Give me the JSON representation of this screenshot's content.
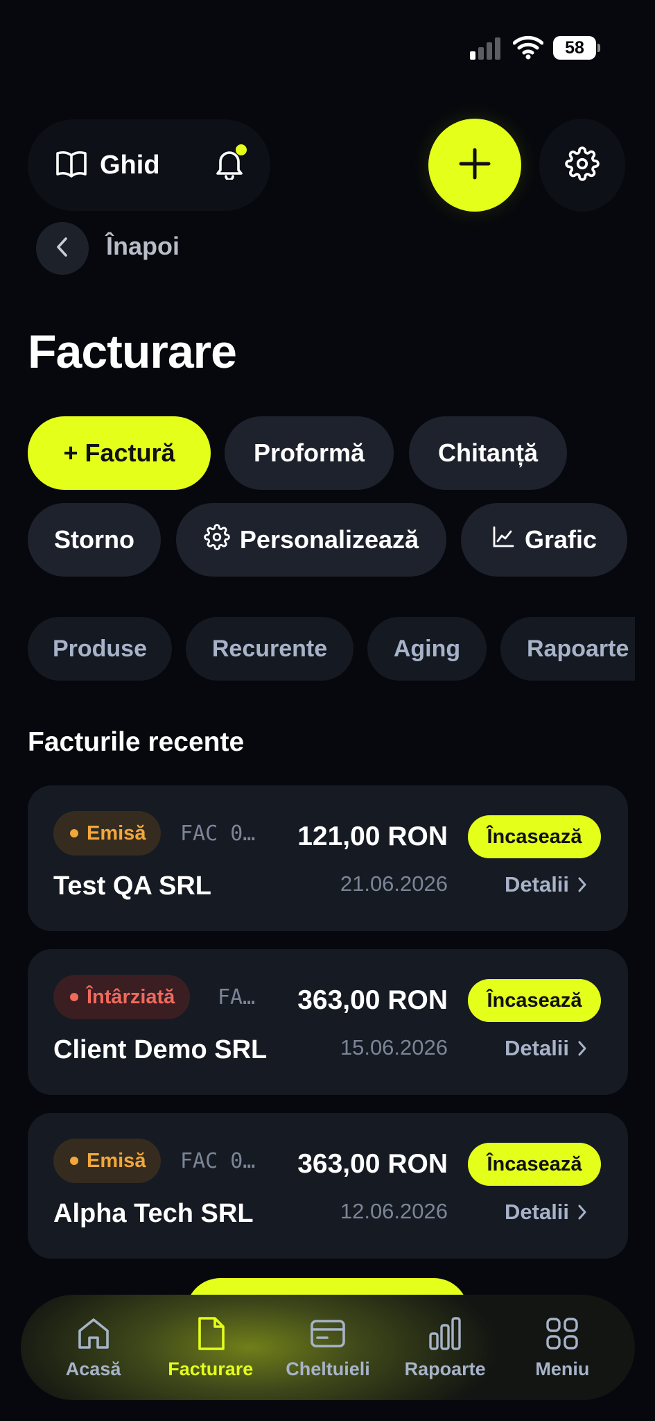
{
  "status_bar": {
    "battery": "58",
    "icons": [
      "signal-icon",
      "wifi-icon",
      "battery-icon"
    ]
  },
  "header": {
    "guide_label": "Ghid",
    "icons": [
      "book-icon",
      "bell-icon",
      "plus-icon",
      "gear-icon"
    ],
    "notification_dot": true
  },
  "back": {
    "label": "Înapoi",
    "icon": "chevron-left-icon"
  },
  "page_title": "Facturare",
  "actions": {
    "invoice": "+ Factură",
    "proforma": "Proformă",
    "receipt": "Chitanță",
    "storno": "Storno",
    "customize": "Personalizează",
    "chart": "Grafic"
  },
  "subnav": [
    "Produse",
    "Recurente",
    "Aging",
    "Rapoarte"
  ],
  "recent": {
    "title": "Facturile recente",
    "items": [
      {
        "status": "Emisă",
        "status_type": "issued",
        "number": "FAC 0…",
        "amount": "121,00 RON",
        "client": "Test QA SRL",
        "date": "21.06.2026",
        "collect": "Încasează",
        "details": "Detalii"
      },
      {
        "status": "Întârziată",
        "status_type": "late",
        "number": "FA…",
        "amount": "363,00 RON",
        "client": "Client Demo SRL",
        "date": "15.06.2026",
        "collect": "Încasează",
        "details": "Detalii"
      },
      {
        "status": "Emisă",
        "status_type": "issued",
        "number": "FAC 0…",
        "amount": "363,00 RON",
        "client": "Alpha Tech SRL",
        "date": "12.06.2026",
        "collect": "Încasează",
        "details": "Detalii"
      }
    ]
  },
  "bottom_nav": [
    {
      "label": "Acasă",
      "icon": "home-icon"
    },
    {
      "label": "Facturare",
      "icon": "document-icon",
      "active": true
    },
    {
      "label": "Cheltuieli",
      "icon": "card-icon"
    },
    {
      "label": "Rapoarte",
      "icon": "bar-chart-icon"
    },
    {
      "label": "Meniu",
      "icon": "grid-icon"
    }
  ],
  "colors": {
    "accent": "#e3ff1a",
    "background": "#06080d",
    "card": "#161a22",
    "issued": "#f2a73b",
    "late": "#f06a5d",
    "muted": "#a7b3c8"
  }
}
